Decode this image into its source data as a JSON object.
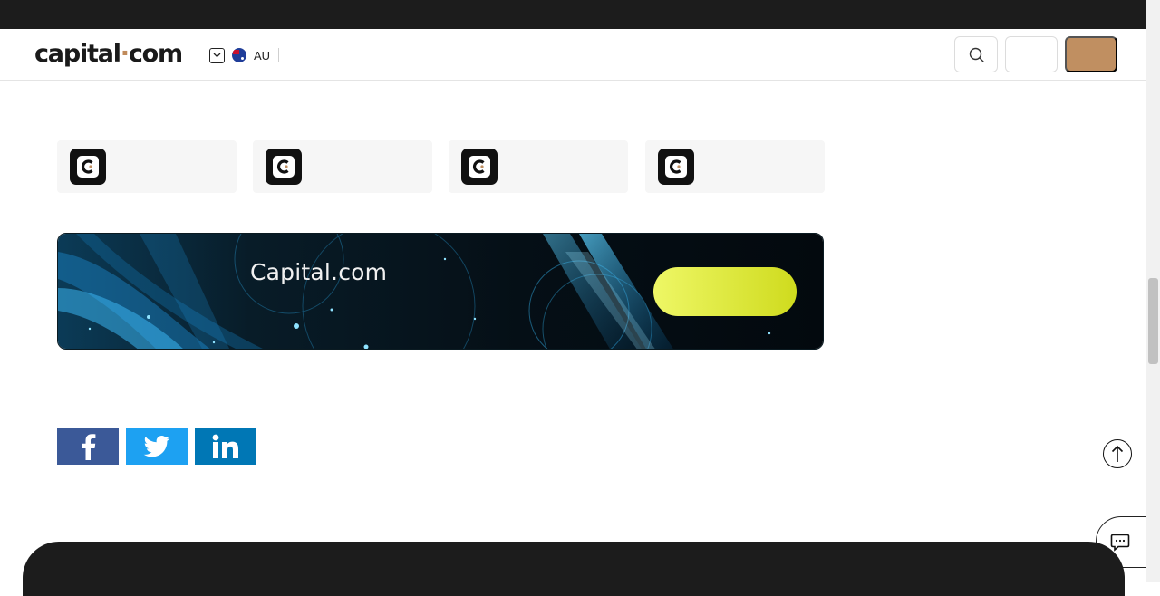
{
  "header": {
    "logo_text_left": "capital",
    "logo_dot": "·",
    "logo_text_right": "com",
    "region_label": "AU",
    "icons": {
      "region_toggle": "chevron-down-icon",
      "flag": "australia-flag-icon",
      "search": "search-icon"
    }
  },
  "apps": {
    "icon_letter": "C",
    "count": 4
  },
  "banner": {
    "title": "Capital.com"
  },
  "share": {
    "facebook": "f",
    "twitter": "twitter-bird-icon",
    "linkedin": "in"
  },
  "colors": {
    "accent": "#c08f61",
    "cta": "#e3ee3f",
    "facebook": "#3b5998",
    "twitter": "#1da1f2",
    "linkedin": "#0077b5",
    "dark": "#1c1c1c"
  }
}
